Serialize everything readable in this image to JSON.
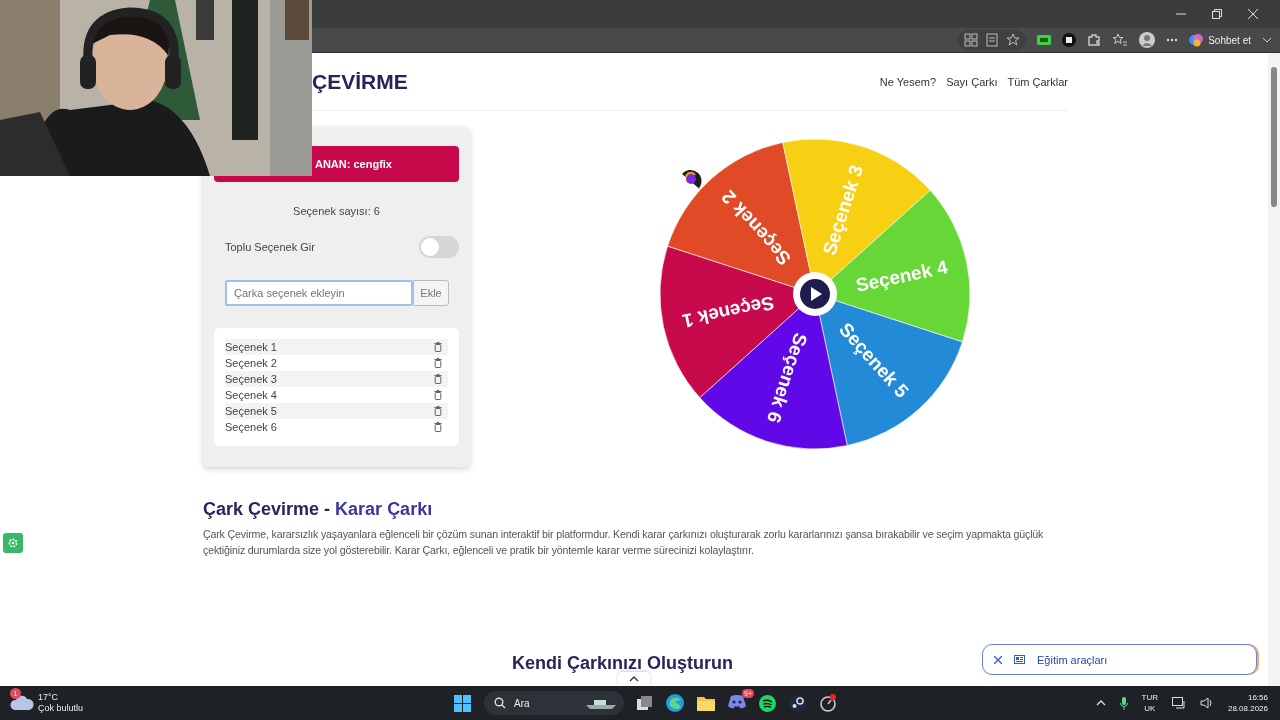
{
  "browser": {
    "chat_button": "Sohbet et"
  },
  "header": {
    "logo": "ÇEVİRME",
    "nav": [
      "Ne Yesem?",
      "Sayı Çarkı",
      "Tüm Çarklar"
    ]
  },
  "panel": {
    "winner": "ANAN: cengfix",
    "count": "Seçenek sayısı: 6",
    "bulk_toggle": {
      "label": "Toplu Seçenek Gir",
      "on": false
    },
    "input": {
      "placeholder": "Çarka seçenek ekleyin"
    },
    "add_button": "Ekle",
    "options": [
      "Seçenek 1",
      "Seçenek 2",
      "Seçenek 3",
      "Seçenek 4",
      "Seçenek 5",
      "Seçenek 6"
    ]
  },
  "wheel": {
    "slices": [
      {
        "label": "Seçenek 1",
        "color": "#c70a4c"
      },
      {
        "label": "Seçenek 2",
        "color": "#e04a26"
      },
      {
        "label": "Seçenek 3",
        "color": "#f7cf13"
      },
      {
        "label": "Seçenek 4",
        "color": "#67d738"
      },
      {
        "label": "Seçenek 5",
        "color": "#238ad8"
      },
      {
        "label": "Seçenek 6",
        "color": "#6108e8"
      }
    ]
  },
  "about": {
    "title_lead": "Çark Çevirme -",
    "title_accent": "Karar Çarkı",
    "text": "Çark Çevirme, kararsızlık yaşayanlara eğlenceli bir çözüm sunan interaktif bir platformdur. Kendi karar çarkınızı oluşturarak zorlu kararlarınızı şansa bırakabilir ve seçim yapmakta güçlük çektiğiniz durumlarda size yol gösterebilir. Karar Çarkı, eğlenceli ve pratik bir yöntemle karar verme sürecinizi kolaylaştırır."
  },
  "create": {
    "title": "Kendi Çarkınızı Oluşturun"
  },
  "edu_popup": {
    "label": "Eğitim araçları"
  },
  "taskbar": {
    "weather_badge": "1",
    "temperature": "17°C",
    "weather": "Çok bulutlu",
    "search": "Ara",
    "discord_badge": "9+",
    "language": "TUR",
    "layout": "UK",
    "time": "16:56",
    "date": "28.08.2026"
  }
}
